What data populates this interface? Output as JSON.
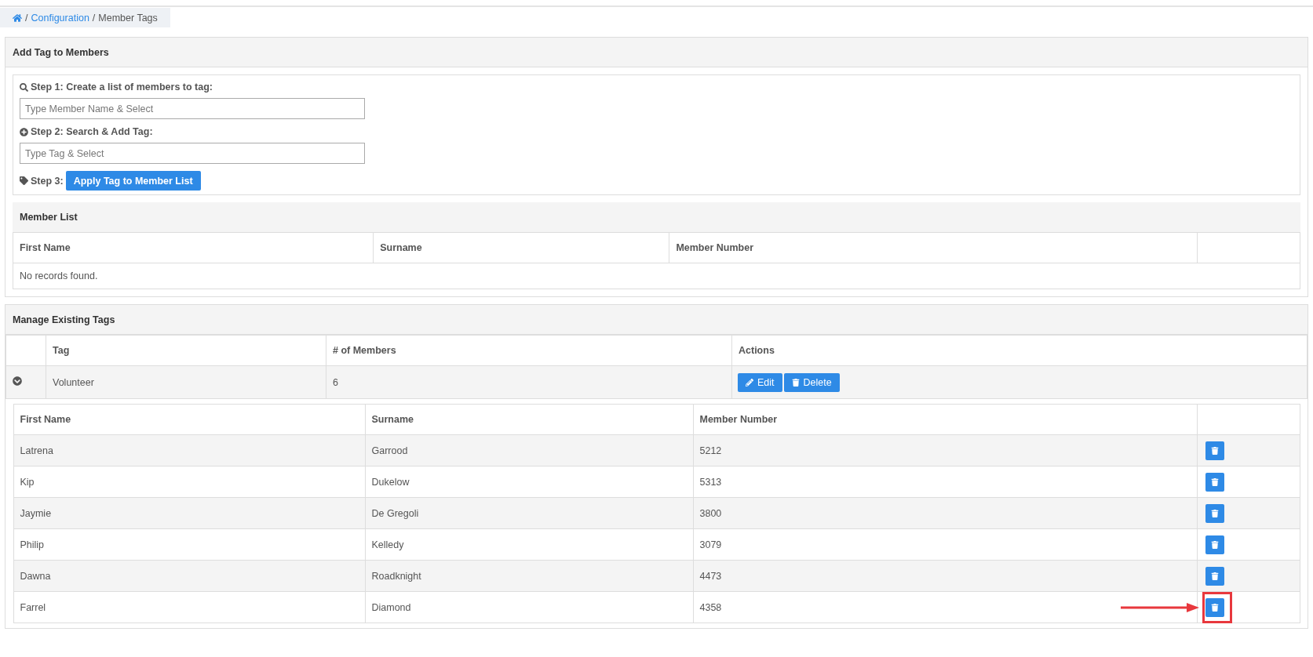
{
  "breadcrumb": {
    "separator": "/",
    "items": [
      {
        "label": "Configuration",
        "current": false
      },
      {
        "label": "Member Tags",
        "current": true
      }
    ]
  },
  "add_panel": {
    "title": "Add Tag to Members",
    "steps": [
      {
        "kind": "field",
        "label": "Step 1: Create a list of members to tag:",
        "placeholder": "Type Member Name & Select"
      },
      {
        "kind": "field",
        "label": "Step 2: Search & Add Tag:",
        "placeholder": "Type Tag & Select"
      },
      {
        "kind": "button",
        "label": "Step 3:",
        "button": "Apply Tag to Member List"
      }
    ],
    "member_list": {
      "title": "Member List",
      "columns": [
        "First Name",
        "Surname",
        "Member Number"
      ],
      "empty": "No records found."
    }
  },
  "manage_panel": {
    "title": "Manage Existing Tags",
    "columns": [
      "Tag",
      "# of Members",
      "Actions"
    ],
    "tags": [
      {
        "tag": "Volunteer",
        "members": "6",
        "expanded": true,
        "edit": "Edit",
        "delete": "Delete",
        "member_columns": [
          "First Name",
          "Surname",
          "Member Number"
        ],
        "rows": [
          {
            "first": "Latrena",
            "surname": "Garrood",
            "number": "5212",
            "highlighted": false
          },
          {
            "first": "Kip",
            "surname": "Dukelow",
            "number": "5313",
            "highlighted": false
          },
          {
            "first": "Jaymie",
            "surname": "De Gregoli",
            "number": "3800",
            "highlighted": false
          },
          {
            "first": "Philip",
            "surname": "Kelledy",
            "number": "3079",
            "highlighted": false
          },
          {
            "first": "Dawna",
            "surname": "Roadknight",
            "number": "4473",
            "highlighted": false
          },
          {
            "first": "Farrel",
            "surname": "Diamond",
            "number": "4358",
            "highlighted": true
          }
        ]
      }
    ]
  }
}
